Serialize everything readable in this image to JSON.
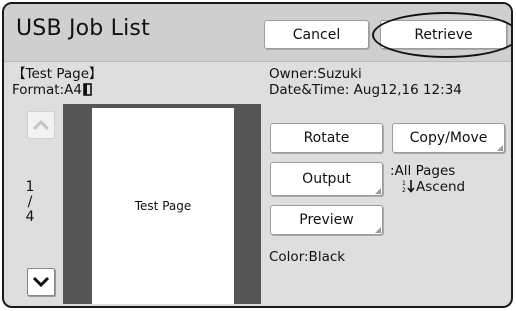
{
  "header": {
    "title": "USB Job List",
    "cancel_label": "Cancel",
    "retrieve_label": "Retrieve"
  },
  "job": {
    "name": "【Test Page】",
    "format": "Format:A4",
    "owner": "Owner:Suzuki",
    "datetime": "Date&Time: Aug12,16 12:34"
  },
  "preview": {
    "page_text": "Test Page",
    "page_current": "1",
    "page_separator": "/",
    "page_total": "4"
  },
  "actions": {
    "rotate_label": "Rotate",
    "copy_move_label": "Copy/Move",
    "output_label": "Output",
    "output_pages": ":All Pages",
    "output_order": "Ascend",
    "preview_label": "Preview",
    "color": "Color:Black"
  },
  "icons": {
    "scroll_up": "chevron-up-icon",
    "scroll_down": "chevron-down-icon",
    "paper_orientation": "portrait-paper-icon",
    "sort": "sort-ascending-icon"
  },
  "colors": {
    "panel_bg": "#dedede",
    "header_bg": "#cfcfcf",
    "preview_frame": "#565656"
  }
}
